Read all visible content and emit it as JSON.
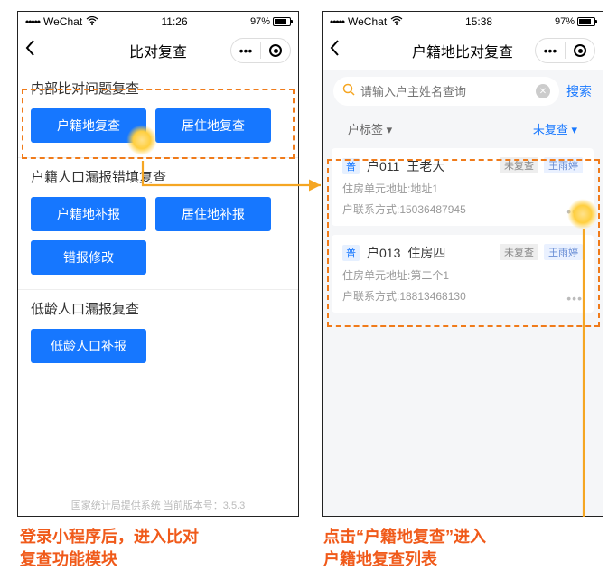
{
  "statusbar": {
    "carrier": "WeChat",
    "time_left": "11:26",
    "time_right": "15:38",
    "battery": "97%"
  },
  "nav": {
    "left_title": "比对复查",
    "right_title": "户籍地比对复查",
    "dots": "•••"
  },
  "left": {
    "s1_title": "内部比对问题复查",
    "s1_b1": "户籍地复查",
    "s1_b2": "居住地复查",
    "s2_title": "户籍人口漏报错填复查",
    "s2_b1": "户籍地补报",
    "s2_b2": "居住地补报",
    "s2_b3": "错报修改",
    "s3_title": "低龄人口漏报复查",
    "s3_b1": "低龄人口补报",
    "footer": "国家统计局提供系统 当前版本号：3.5.3"
  },
  "right": {
    "search_placeholder": "请输入户主姓名查询",
    "search_btn": "搜索",
    "filter1": "户标签",
    "filter2": "未复查",
    "arrow": "▾",
    "cards": [
      {
        "tag": "普",
        "code": "户011",
        "name": "王老大",
        "status": "未复查",
        "owner": "王雨婷",
        "addr": "住房单元地址:地址1",
        "phone": "户联系方式:15036487945"
      },
      {
        "tag": "普",
        "code": "户013",
        "name": "住房四",
        "status": "未复查",
        "owner": "王雨婷",
        "addr": "住房单元地址:第二个1",
        "phone": "户联系方式:18813468130"
      }
    ],
    "more": "•••"
  },
  "captions": {
    "c1": "登录小程序后，进入比对\n复查功能模块",
    "c2": "点击“户籍地复查”进入\n户籍地复查列表"
  }
}
